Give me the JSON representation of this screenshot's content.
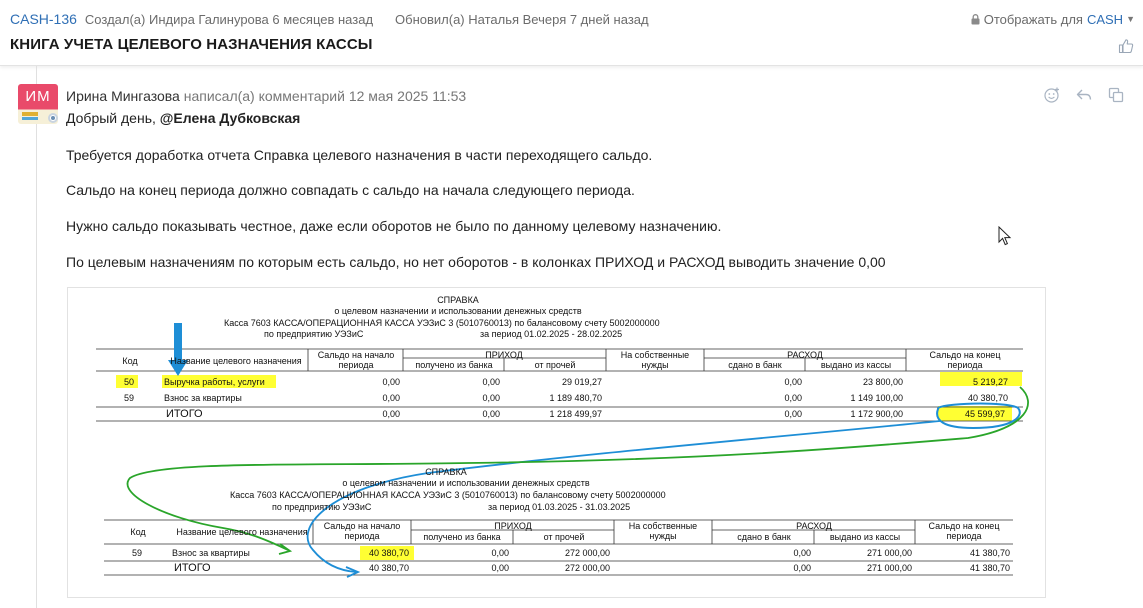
{
  "header": {
    "issue_key": "CASH-136",
    "created": "Создал(а) Индира Галинурова 6 месяцев назад",
    "updated": "Обновил(а) Наталья Вечеря 7 дней назад",
    "visibility_label": "Отображать для",
    "visibility_value": "CASH",
    "title": "КНИГА УЧЕТА ЦЕЛЕВОГО НАЗНАЧЕНИЯ КАССЫ"
  },
  "comment": {
    "avatar_initials": "ИМ",
    "author": "Ирина Мингазова",
    "action": "написал(а) комментарий",
    "date": "12 мая 2025 11:53",
    "greeting": "Добрый день,",
    "mention": "@Елена Дубковская",
    "paragraphs": [
      "Требуется доработка отчета Справка целевого назначения в части переходящего сальдо.",
      "Сальдо на конец периода должно совпадать с сальдо на начала следующего периода.",
      "Нужно сальдо показывать честное, даже если оборотов не было по данному целевому назначению.",
      "По целевым назначениям по которым есть сальдо, но нет оборотов - в колонках ПРИХОД и РАСХОД выводить значение 0,00"
    ]
  },
  "report": {
    "columns": {
      "code": "Код",
      "name": "Название целевого назначения",
      "opening": "Сальдо на начало периода",
      "income": "ПРИХОД",
      "income_bank": "получено из банка",
      "income_other": "от прочей",
      "own_needs": "На собственные нужды",
      "expense": "РАСХОД",
      "expense_bank": "сдано в банк",
      "expense_cash": "выдано из кассы",
      "closing": "Сальдо на конец периода"
    },
    "block1": {
      "title": "СПРАВКА",
      "subtitle": "о целевом назначении и использовании денежных средств",
      "cashbox": "Касса 7603 КАССА/ОПЕРАЦИОННАЯ КАССА УЭЗиС 3 (5010760013) по балансовому счету 5002000000",
      "enterprise": "по предприятию УЭЗиС",
      "period": "за период 01.02.2025 - 28.02.2025",
      "rows": [
        {
          "code": "50",
          "name": "Выручка работы, услуги",
          "opening": "0,00",
          "income_bank": "0,00",
          "income_other": "29 019,27",
          "own_needs": "",
          "expense_bank": "0,00",
          "expense_cash": "23 800,00",
          "closing": "5 219,27"
        },
        {
          "code": "59",
          "name": "Взнос за квартиры",
          "opening": "0,00",
          "income_bank": "0,00",
          "income_other": "1 189 480,70",
          "own_needs": "",
          "expense_bank": "0,00",
          "expense_cash": "1 149 100,00",
          "closing": "40 380,70"
        }
      ],
      "total": {
        "label": "ИТОГО",
        "opening": "0,00",
        "income_bank": "0,00",
        "income_other": "1 218 499,97",
        "expense_bank": "0,00",
        "expense_cash": "1 172 900,00",
        "closing": "45 599,97"
      }
    },
    "block2": {
      "title": "СПРАВКА",
      "subtitle": "о целевом назначении и использовании денежных средств",
      "cashbox": "Касса 7603 КАССА/ОПЕРАЦИОННАЯ КАССА УЭЗиС 3 (5010760013) по балансовому счету 5002000000",
      "enterprise": "по предприятию УЭЗиС",
      "period": "за период 01.03.2025 - 31.03.2025",
      "rows": [
        {
          "code": "59",
          "name": "Взнос за квартиры",
          "opening": "40 380,70",
          "income_bank": "0,00",
          "income_other": "272 000,00",
          "own_needs": "",
          "expense_bank": "0,00",
          "expense_cash": "271 000,00",
          "closing": "41 380,70"
        }
      ],
      "total": {
        "label": "ИТОГО",
        "opening": "40 380,70",
        "income_bank": "0,00",
        "income_other": "272 000,00",
        "expense_bank": "0,00",
        "expense_cash": "271 000,00",
        "closing": "41 380,70"
      }
    },
    "colors": {
      "highlight": "#ffff33",
      "arrow_blue": "#1e8ed6",
      "green_line": "#2aa52a"
    }
  }
}
